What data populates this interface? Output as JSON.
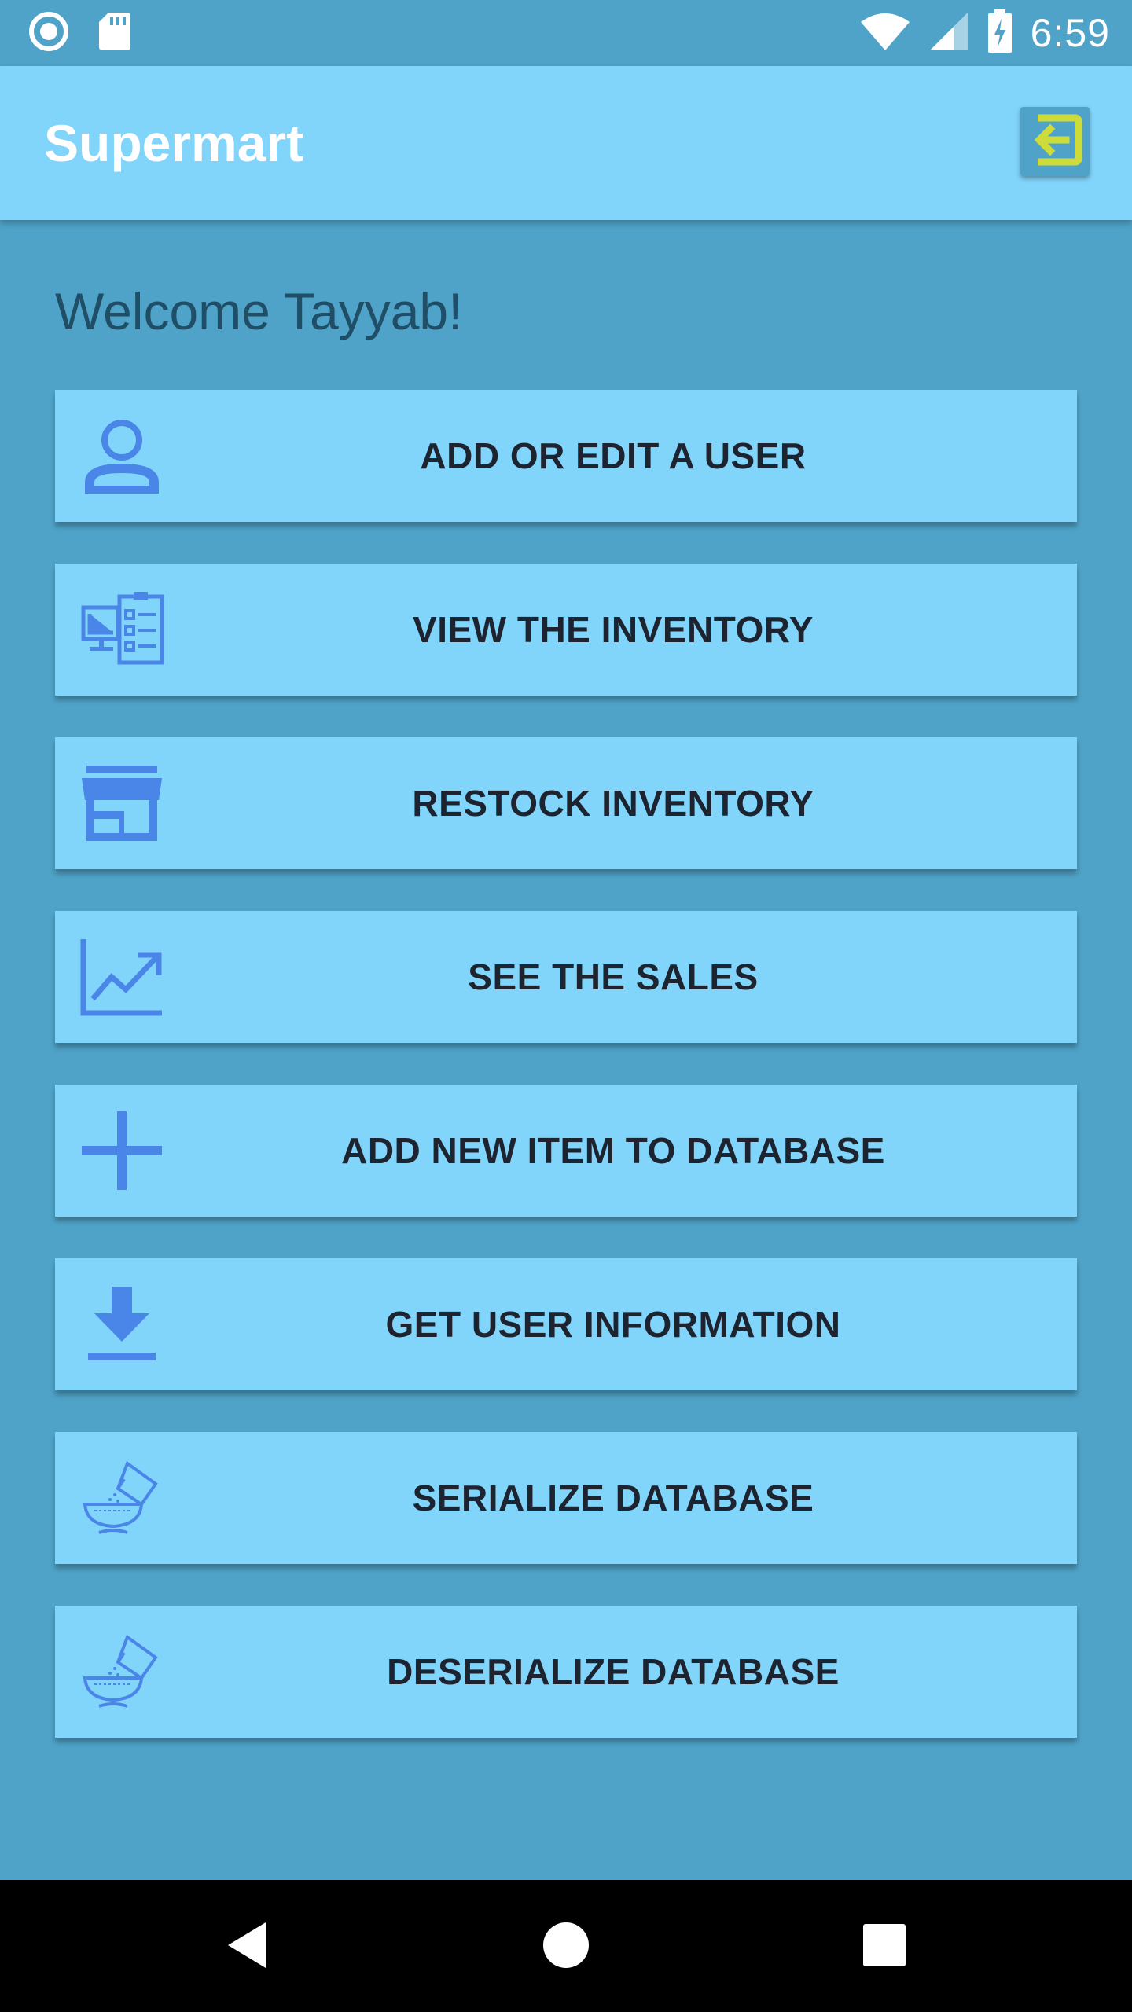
{
  "status_bar": {
    "time": "6:59",
    "icons": [
      "circle-record-icon",
      "sd-card-icon",
      "wifi-icon",
      "signal-icon",
      "battery-charging-icon"
    ]
  },
  "app_bar": {
    "title": "Supermart",
    "action_icon": "logout-icon"
  },
  "welcome_text": "Welcome Tayyab!",
  "menu": [
    {
      "label": "ADD OR EDIT A USER",
      "icon": "user-icon"
    },
    {
      "label": "VIEW THE INVENTORY",
      "icon": "inventory-icon"
    },
    {
      "label": "RESTOCK INVENTORY",
      "icon": "store-icon"
    },
    {
      "label": "SEE THE SALES",
      "icon": "chart-trend-icon"
    },
    {
      "label": "ADD NEW ITEM TO DATABASE",
      "icon": "plus-icon"
    },
    {
      "label": "GET USER INFORMATION",
      "icon": "download-icon"
    },
    {
      "label": "SERIALIZE DATABASE",
      "icon": "pour-bowl-icon"
    },
    {
      "label": "DESERIALIZE DATABASE",
      "icon": "pour-bowl-icon"
    }
  ],
  "nav_bar": {
    "icons": [
      "back-icon",
      "home-icon",
      "recents-icon"
    ]
  },
  "colors": {
    "background": "#4FA3C8",
    "app_bar": "#81D4FA",
    "button": "#81D4FA",
    "icon_accent": "#4A86E8",
    "logout_accent": "#CDDC39"
  }
}
